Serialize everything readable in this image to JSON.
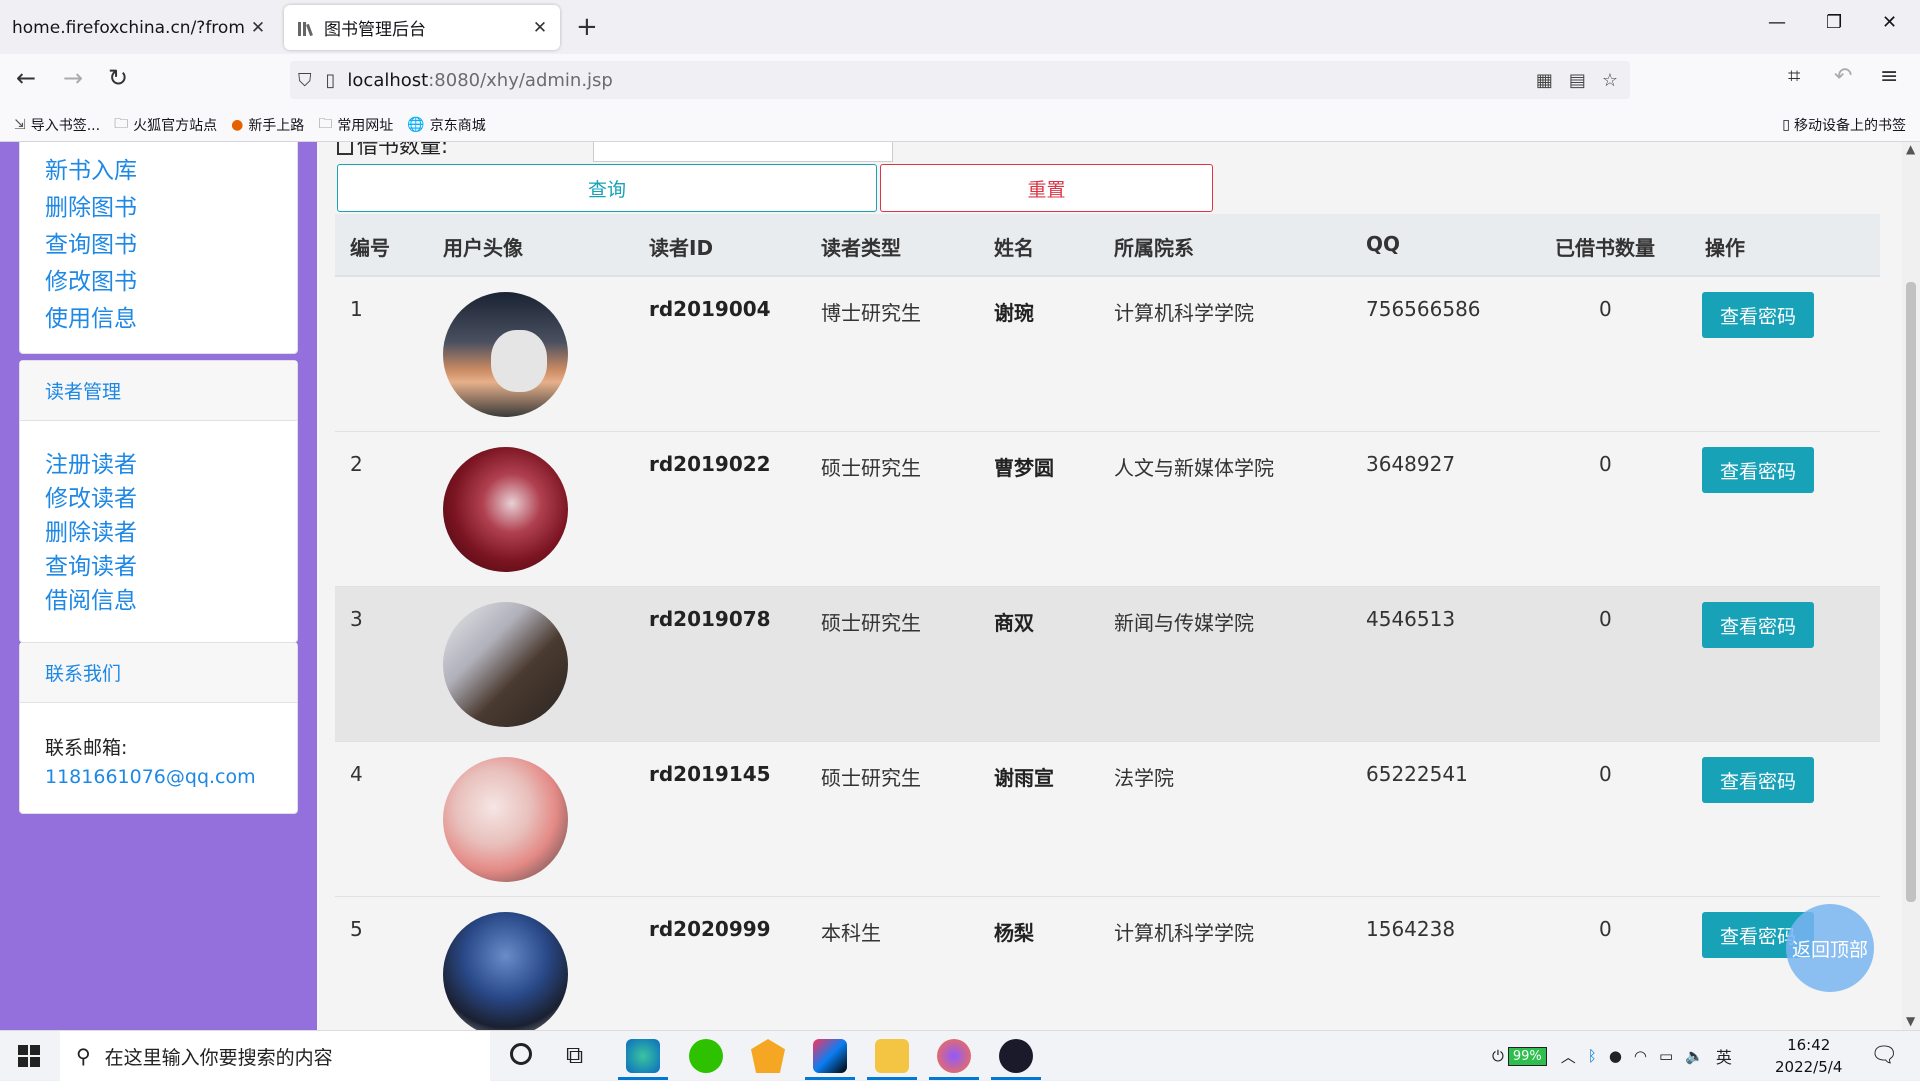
{
  "browser": {
    "tabs": [
      {
        "title": "home.firefoxchina.cn/?from=extra_start"
      },
      {
        "title": "图书管理后台"
      }
    ],
    "url_host": "localhost",
    "url_path": ":8080/xhy/admin.jsp",
    "bookmarks": [
      "导入书签...",
      "火狐官方站点",
      "新手上路",
      "常用网址",
      "京东商城"
    ],
    "mobile_bookmarks": "移动设备上的书签"
  },
  "sidebar": {
    "book_menu": [
      "新书入库",
      "删除图书",
      "查询图书",
      "修改图书",
      "使用信息"
    ],
    "reader_header": "读者管理",
    "reader_menu": [
      "注册读者",
      "修改读者",
      "删除读者",
      "查询读者",
      "借阅信息"
    ],
    "contact_header": "联系我们",
    "contact_label": "联系邮箱:",
    "contact_email": "1181661076@qq.com"
  },
  "form": {
    "partial_label": "借书数量:",
    "query_button": "查询",
    "reset_button": "重置"
  },
  "table": {
    "headers": [
      "编号",
      "用户头像",
      "读者ID",
      "读者类型",
      "姓名",
      "所属院系",
      "QQ",
      "已借书数量",
      "操作"
    ],
    "rows": [
      {
        "no": "1",
        "id": "rd2019004",
        "type": "博士研究生",
        "name": "谢琬",
        "dept": "计算机科学学院",
        "qq": "756566586",
        "count": "0",
        "action": "查看密码"
      },
      {
        "no": "2",
        "id": "rd2019022",
        "type": "硕士研究生",
        "name": "曹梦圆",
        "dept": "人文与新媒体学院",
        "qq": "3648927",
        "count": "0",
        "action": "查看密码"
      },
      {
        "no": "3",
        "id": "rd2019078",
        "type": "硕士研究生",
        "name": "商双",
        "dept": "新闻与传媒学院",
        "qq": "4546513",
        "count": "0",
        "action": "查看密码"
      },
      {
        "no": "4",
        "id": "rd2019145",
        "type": "硕士研究生",
        "name": "谢雨宣",
        "dept": "法学院",
        "qq": "65222541",
        "count": "0",
        "action": "查看密码"
      },
      {
        "no": "5",
        "id": "rd2020999",
        "type": "本科生",
        "name": "杨梨",
        "dept": "计算机科学学院",
        "qq": "1564238",
        "count": "0",
        "action": "查看密码"
      }
    ]
  },
  "back_to_top": "返回顶部",
  "taskbar": {
    "search_placeholder": "在这里输入你要搜索的内容",
    "battery": "99%",
    "ime": "英",
    "time": "16:42",
    "date": "2022/5/4"
  }
}
